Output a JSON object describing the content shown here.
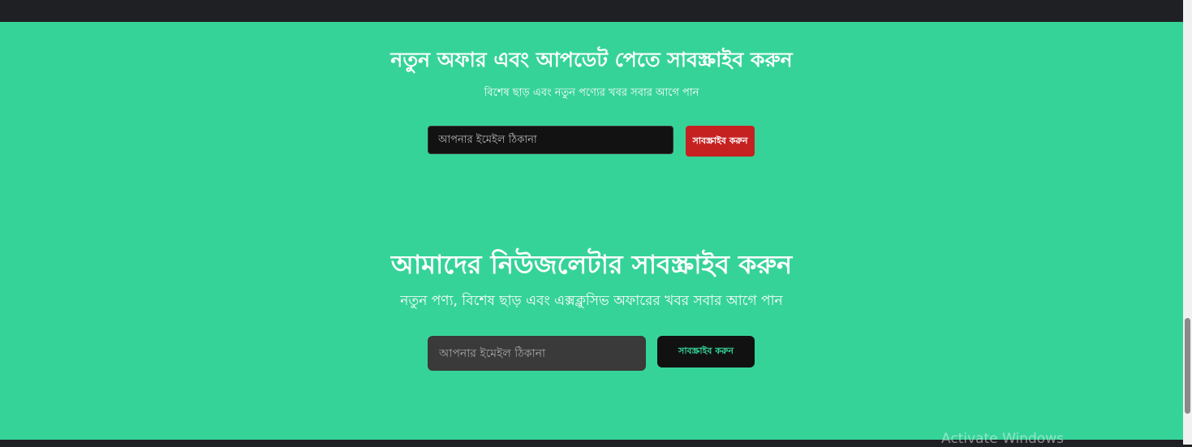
{
  "offer_section": {
    "title": "নতুন অফার এবং আপডেট পেতে সাবস্ক্রাইব করুন",
    "subtitle": "বিশেষ ছাড় এবং নতুন পণ্যের খবর সবার আগে পান",
    "email_placeholder": "আপনার ইমেইল ঠিকানা",
    "subscribe_label": "সাবস্ক্রাইব করুন"
  },
  "newsletter_section": {
    "title": "আমাদের নিউজলেটার সাবস্ক্রাইব করুন",
    "subtitle": "নতুন পণ্য, বিশেষ ছাড় এবং এক্সক্লুসিভ অফারের খবর সবার আগে পান",
    "email_placeholder": "আপনার ইমেইল ঠিকানা",
    "subscribe_label": "সাবস্ক্রাইব করুন"
  },
  "os_watermark": "Activate Windows",
  "colors": {
    "background": "#36d399",
    "offer_button": "#c62121",
    "newsletter_button": "#111111",
    "newsletter_button_text": "#36d399"
  }
}
